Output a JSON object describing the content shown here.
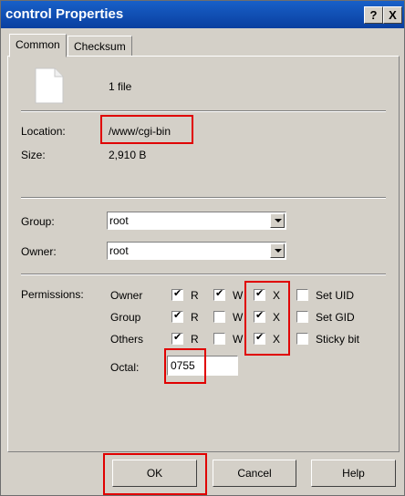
{
  "window": {
    "title": "control Properties",
    "help_button": "?",
    "close_button": "X"
  },
  "tabs": [
    {
      "label": "Common",
      "active": true
    },
    {
      "label": "Checksum",
      "active": false
    }
  ],
  "file": {
    "count_text": "1 file",
    "icon": "file-icon"
  },
  "info": {
    "location_label": "Location:",
    "location_value": "/www/cgi-bin",
    "size_label": "Size:",
    "size_value": "2,910 B"
  },
  "ownership": {
    "group_label": "Group:",
    "group_value": "root",
    "owner_label": "Owner:",
    "owner_value": "root"
  },
  "permissions": {
    "label": "Permissions:",
    "rows": [
      {
        "name": "Owner",
        "r": true,
        "w": true,
        "x": true,
        "extra_label": "Set UID",
        "extra": false
      },
      {
        "name": "Group",
        "r": true,
        "w": false,
        "x": true,
        "extra_label": "Set GID",
        "extra": false
      },
      {
        "name": "Others",
        "r": true,
        "w": false,
        "x": true,
        "extra_label": "Sticky bit",
        "extra": false
      }
    ],
    "r_label": "R",
    "w_label": "W",
    "x_label": "X",
    "octal_label": "Octal:",
    "octal_value": "0755"
  },
  "buttons": {
    "ok": "OK",
    "cancel": "Cancel",
    "help": "Help"
  },
  "colors": {
    "title_bar": "#0a3fa0",
    "highlight": "#e00000"
  }
}
